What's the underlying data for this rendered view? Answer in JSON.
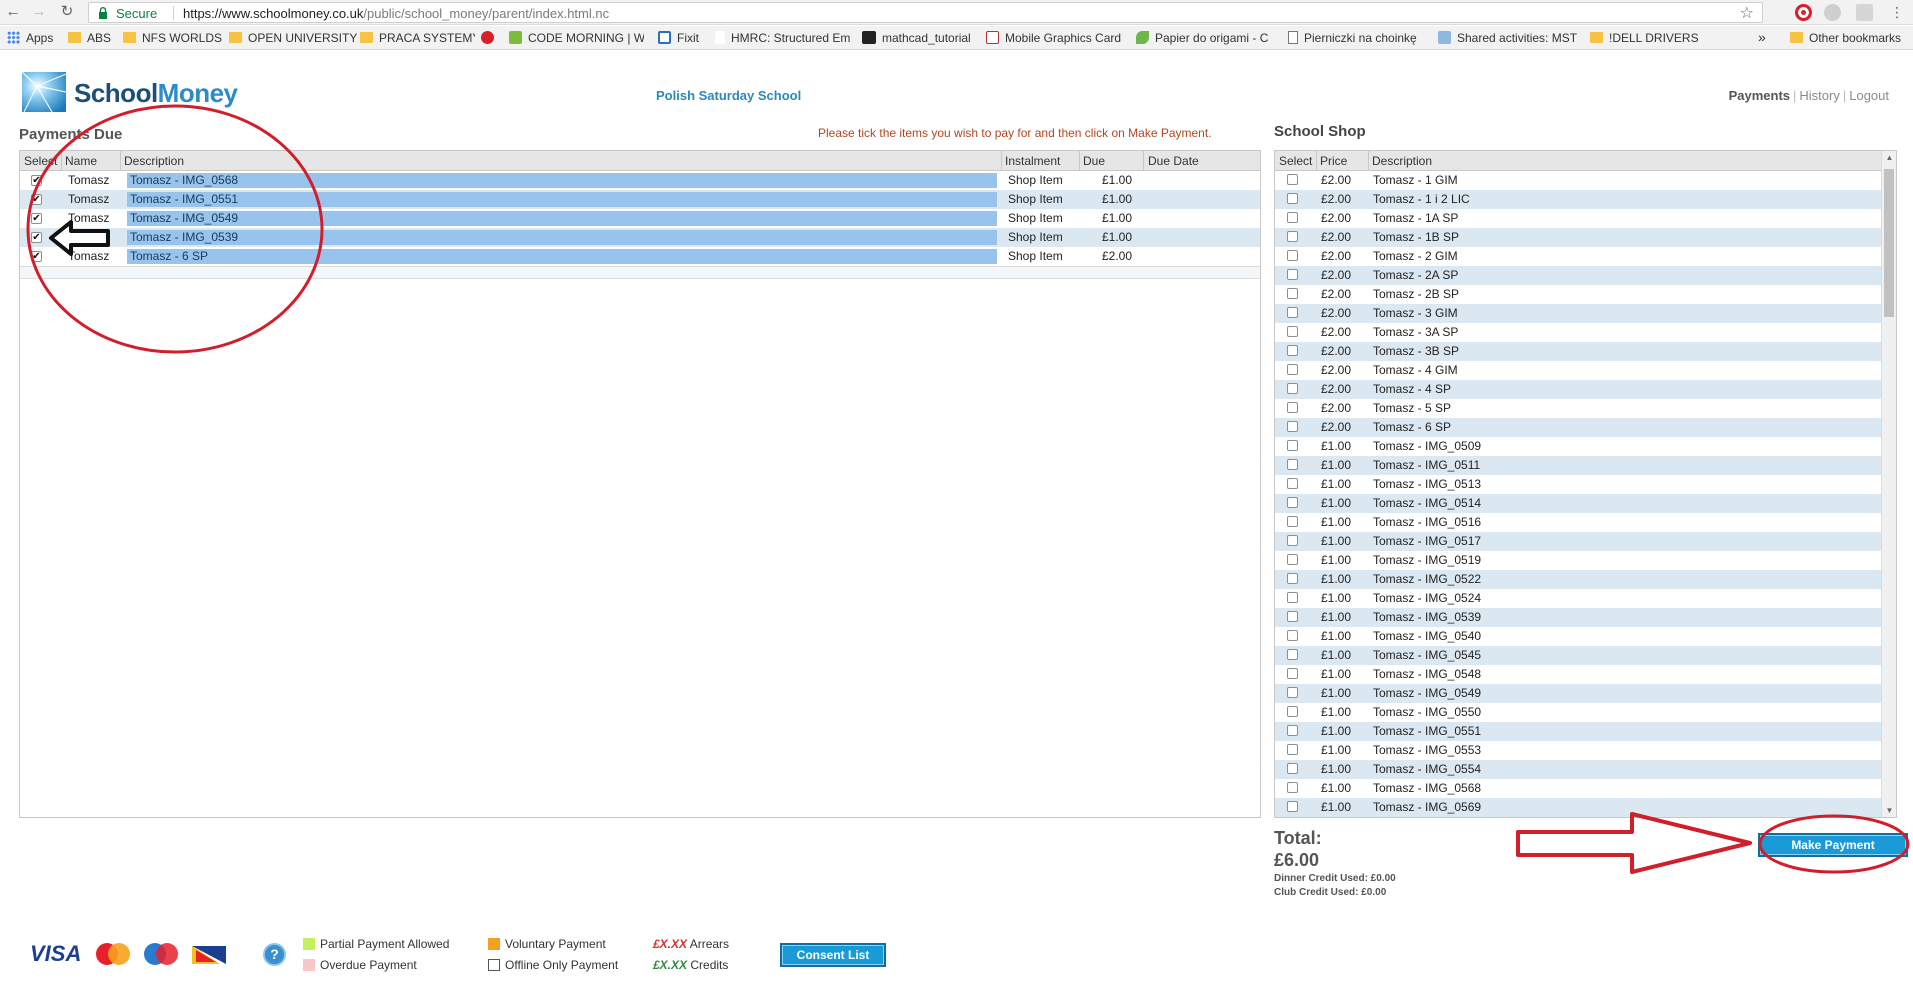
{
  "browser": {
    "secure_label": "Secure",
    "url_host": "https://www.schoolmoney.co.uk",
    "url_path": "/public/school_money/parent/index.html.nc",
    "bookmarks": [
      {
        "label": "Apps",
        "icon": "apps-icon"
      },
      {
        "label": "ABS",
        "icon": "folder-icon"
      },
      {
        "label": "NFS WORLDS",
        "icon": "folder-icon"
      },
      {
        "label": "OPEN UNIVERSITY",
        "icon": "folder-icon"
      },
      {
        "label": "PRACA SYSTEMY",
        "icon": "folder-icon"
      },
      {
        "label": "",
        "icon": "red-circle-icon"
      },
      {
        "label": "CODE MORNING | W",
        "icon": "code-morning-icon"
      },
      {
        "label": "Fixit",
        "icon": "fixit-icon"
      },
      {
        "label": "HMRC: Structured Em",
        "icon": "page-icon"
      },
      {
        "label": "mathcad_tutorial",
        "icon": "mathcad-icon"
      },
      {
        "label": "Mobile Graphics Card",
        "icon": "mobile-icon"
      },
      {
        "label": "Papier do origami - C",
        "icon": "leaf-icon"
      },
      {
        "label": "Pierniczki na choinkę",
        "icon": "page-icon"
      },
      {
        "label": "Shared activities: MST",
        "icon": "shared-icon"
      },
      {
        "label": "!DELL DRIVERS",
        "icon": "folder-icon"
      }
    ],
    "more_label": "»",
    "other_bookmarks": "Other bookmarks"
  },
  "header": {
    "logo_school": "School",
    "logo_money": "Money",
    "school_name": "Polish Saturday School",
    "nav": [
      "Payments",
      "History",
      "Logout"
    ]
  },
  "payments_due": {
    "title": "Payments Due",
    "instruction": "Please tick the items you wish to pay for and then click on Make Payment.",
    "columns": [
      "Select",
      "Name",
      "Description",
      "Instalment",
      "Due",
      "Due Date"
    ],
    "rows": [
      {
        "checked": true,
        "name": "Tomasz",
        "description": "Tomasz - IMG_0568",
        "instalment": "Shop Item",
        "due": "£1.00",
        "due_date": ""
      },
      {
        "checked": true,
        "name": "Tomasz",
        "description": "Tomasz - IMG_0551",
        "instalment": "Shop Item",
        "due": "£1.00",
        "due_date": ""
      },
      {
        "checked": true,
        "name": "Tomasz",
        "description": "Tomasz - IMG_0549",
        "instalment": "Shop Item",
        "due": "£1.00",
        "due_date": ""
      },
      {
        "checked": true,
        "name": "Tomasz",
        "description": "Tomasz - IMG_0539",
        "instalment": "Shop Item",
        "due": "£1.00",
        "due_date": ""
      },
      {
        "checked": true,
        "name": "Tomasz",
        "description": "Tomasz - 6 SP",
        "instalment": "Shop Item",
        "due": "£2.00",
        "due_date": ""
      }
    ]
  },
  "school_shop": {
    "title": "School Shop",
    "columns": [
      "Select",
      "Price",
      "Description"
    ],
    "items": [
      {
        "price": "£2.00",
        "description": "Tomasz - 1 GIM"
      },
      {
        "price": "£2.00",
        "description": "Tomasz - 1 i 2 LIC"
      },
      {
        "price": "£2.00",
        "description": "Tomasz - 1A SP"
      },
      {
        "price": "£2.00",
        "description": "Tomasz - 1B SP"
      },
      {
        "price": "£2.00",
        "description": "Tomasz - 2 GIM"
      },
      {
        "price": "£2.00",
        "description": "Tomasz - 2A SP"
      },
      {
        "price": "£2.00",
        "description": "Tomasz - 2B SP"
      },
      {
        "price": "£2.00",
        "description": "Tomasz - 3 GIM"
      },
      {
        "price": "£2.00",
        "description": "Tomasz - 3A SP"
      },
      {
        "price": "£2.00",
        "description": "Tomasz - 3B SP"
      },
      {
        "price": "£2.00",
        "description": "Tomasz - 4 GIM"
      },
      {
        "price": "£2.00",
        "description": "Tomasz - 4 SP"
      },
      {
        "price": "£2.00",
        "description": "Tomasz - 5 SP"
      },
      {
        "price": "£2.00",
        "description": "Tomasz - 6 SP"
      },
      {
        "price": "£1.00",
        "description": "Tomasz - IMG_0509"
      },
      {
        "price": "£1.00",
        "description": "Tomasz - IMG_0511"
      },
      {
        "price": "£1.00",
        "description": "Tomasz - IMG_0513"
      },
      {
        "price": "£1.00",
        "description": "Tomasz - IMG_0514"
      },
      {
        "price": "£1.00",
        "description": "Tomasz - IMG_0516"
      },
      {
        "price": "£1.00",
        "description": "Tomasz - IMG_0517"
      },
      {
        "price": "£1.00",
        "description": "Tomasz - IMG_0519"
      },
      {
        "price": "£1.00",
        "description": "Tomasz - IMG_0522"
      },
      {
        "price": "£1.00",
        "description": "Tomasz - IMG_0524"
      },
      {
        "price": "£1.00",
        "description": "Tomasz - IMG_0539"
      },
      {
        "price": "£1.00",
        "description": "Tomasz - IMG_0540"
      },
      {
        "price": "£1.00",
        "description": "Tomasz - IMG_0545"
      },
      {
        "price": "£1.00",
        "description": "Tomasz - IMG_0548"
      },
      {
        "price": "£1.00",
        "description": "Tomasz - IMG_0549"
      },
      {
        "price": "£1.00",
        "description": "Tomasz - IMG_0550"
      },
      {
        "price": "£1.00",
        "description": "Tomasz - IMG_0551"
      },
      {
        "price": "£1.00",
        "description": "Tomasz - IMG_0553"
      },
      {
        "price": "£1.00",
        "description": "Tomasz - IMG_0554"
      },
      {
        "price": "£1.00",
        "description": "Tomasz - IMG_0568"
      },
      {
        "price": "£1.00",
        "description": "Tomasz - IMG_0569"
      }
    ]
  },
  "totals": {
    "label": "Total:",
    "amount": "£6.00",
    "dinner_credit": "Dinner Credit Used: £0.00",
    "club_credit": "Club Credit Used: £0.00",
    "make_payment": "Make Payment"
  },
  "footer": {
    "cards": [
      "VISA",
      "MasterCard",
      "Maestro",
      "DELTA"
    ],
    "help": "?",
    "legend": {
      "partial": "Partial Payment Allowed",
      "overdue": "Overdue Payment",
      "voluntary": "Voluntary Payment",
      "offline": "Offline Only Payment",
      "arrears_code": "£X.XX",
      "arrears": "Arrears",
      "credits_code": "£X.XX",
      "credits": "Credits"
    },
    "consent_list": "Consent List"
  },
  "colors": {
    "brand_blue": "#1a9ad6",
    "row_alt": "#dbe8f2",
    "row_highlight": "#98c3ec",
    "instruction": "#b4461f",
    "annotation_red": "#d01f2b",
    "partial_swatch": "#c6f060",
    "overdue_swatch": "#f8c8c8",
    "voluntary_swatch": "#f4a020",
    "arrears": "#d0312d",
    "credits": "#2e8b3e"
  }
}
